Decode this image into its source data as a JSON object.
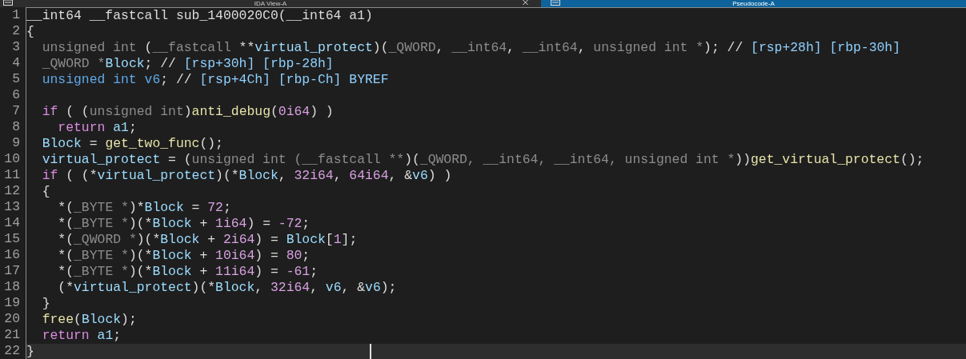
{
  "tabs": [
    {
      "label": "IDA View-A",
      "selected": false,
      "closable": true
    },
    {
      "label": "Pseudocode-A",
      "selected": true,
      "closable": false
    }
  ],
  "lines": [
    {
      "number": "1",
      "selected": false,
      "tokens": [
        {
          "kind": "plain",
          "text": "__int64 __fastcall sub_1400020C0(__int64 a1)"
        }
      ]
    },
    {
      "number": "2",
      "selected": false,
      "tokens": [
        {
          "kind": "plain",
          "text": "{"
        }
      ]
    },
    {
      "number": "3",
      "selected": false,
      "tokens": [
        {
          "kind": "type",
          "text": "  unsigned int"
        },
        {
          "kind": "plain",
          "text": " ("
        },
        {
          "kind": "type",
          "text": "__fastcall"
        },
        {
          "kind": "plain",
          "text": " **"
        },
        {
          "kind": "variable",
          "text": "virtual_protect"
        },
        {
          "kind": "plain",
          "text": ")("
        },
        {
          "kind": "type",
          "text": "_QWORD"
        },
        {
          "kind": "plain",
          "text": ", "
        },
        {
          "kind": "type",
          "text": "__int64"
        },
        {
          "kind": "plain",
          "text": ", "
        },
        {
          "kind": "type",
          "text": "__int64"
        },
        {
          "kind": "plain",
          "text": ", "
        },
        {
          "kind": "type",
          "text": "unsigned int *"
        },
        {
          "kind": "plain",
          "text": "); // "
        },
        {
          "kind": "ref",
          "text": "[rsp+28h] [rbp-30h]"
        }
      ]
    },
    {
      "number": "4",
      "selected": false,
      "tokens": [
        {
          "kind": "type",
          "text": "  _QWORD *"
        },
        {
          "kind": "variable",
          "text": "Block"
        },
        {
          "kind": "plain",
          "text": "; // "
        },
        {
          "kind": "ref",
          "text": "[rsp+30h] [rbp-28h]"
        }
      ]
    },
    {
      "number": "5",
      "selected": false,
      "tokens": [
        {
          "kind": "decl",
          "text": "  unsigned int v6"
        },
        {
          "kind": "plain",
          "text": "; // "
        },
        {
          "kind": "ref",
          "text": "[rsp+4Ch] [rbp-Ch] BYREF"
        }
      ]
    },
    {
      "number": "6",
      "selected": false
    },
    {
      "number": "7",
      "selected": false,
      "tokens": [
        {
          "kind": "keyword",
          "text": "  if"
        },
        {
          "kind": "plain",
          "text": " ( ("
        },
        {
          "kind": "type",
          "text": "unsigned int"
        },
        {
          "kind": "plain",
          "text": ")"
        },
        {
          "kind": "function",
          "text": "anti_debug"
        },
        {
          "kind": "plain",
          "text": "("
        },
        {
          "kind": "number",
          "text": "0i64"
        },
        {
          "kind": "plain",
          "text": ") )"
        }
      ]
    },
    {
      "number": "8",
      "selected": false,
      "tokens": [
        {
          "kind": "keyword",
          "text": "    return"
        },
        {
          "kind": "variable",
          "text": " a1"
        },
        {
          "kind": "plain",
          "text": ";"
        }
      ]
    },
    {
      "number": "9",
      "selected": false,
      "tokens": [
        {
          "kind": "variable",
          "text": "  Block"
        },
        {
          "kind": "plain",
          "text": " = "
        },
        {
          "kind": "function",
          "text": "get_two_func"
        },
        {
          "kind": "plain",
          "text": "();"
        }
      ]
    },
    {
      "number": "10",
      "selected": false,
      "tokens": [
        {
          "kind": "variable",
          "text": "  virtual_protect"
        },
        {
          "kind": "plain",
          "text": " = ("
        },
        {
          "kind": "type",
          "text": "unsigned int (__fastcall **"
        },
        {
          "kind": "plain",
          "text": ")("
        },
        {
          "kind": "type",
          "text": "_QWORD, __int64, __int64, unsigned int *"
        },
        {
          "kind": "plain",
          "text": "))"
        },
        {
          "kind": "function",
          "text": "get_virtual_protect"
        },
        {
          "kind": "plain",
          "text": "();"
        }
      ]
    },
    {
      "number": "11",
      "selected": false,
      "tokens": [
        {
          "kind": "keyword",
          "text": "  if"
        },
        {
          "kind": "plain",
          "text": " ( (*"
        },
        {
          "kind": "variable",
          "text": "virtual_protect"
        },
        {
          "kind": "plain",
          "text": ")(*"
        },
        {
          "kind": "variable",
          "text": "Block"
        },
        {
          "kind": "plain",
          "text": ", "
        },
        {
          "kind": "number",
          "text": "32i64"
        },
        {
          "kind": "plain",
          "text": ", "
        },
        {
          "kind": "number",
          "text": "64i64"
        },
        {
          "kind": "plain",
          "text": ", &"
        },
        {
          "kind": "variable",
          "text": "v6"
        },
        {
          "kind": "plain",
          "text": ") )"
        }
      ]
    },
    {
      "number": "12",
      "selected": false,
      "tokens": [
        {
          "kind": "plain",
          "text": "  {"
        }
      ]
    },
    {
      "number": "13",
      "selected": false,
      "tokens": [
        {
          "kind": "plain",
          "text": "    *("
        },
        {
          "kind": "type",
          "text": "_BYTE *"
        },
        {
          "kind": "plain",
          "text": ")*"
        },
        {
          "kind": "variable",
          "text": "Block"
        },
        {
          "kind": "plain",
          "text": " = "
        },
        {
          "kind": "number",
          "text": "72"
        },
        {
          "kind": "plain",
          "text": ";"
        }
      ]
    },
    {
      "number": "14",
      "selected": false,
      "tokens": [
        {
          "kind": "plain",
          "text": "    *("
        },
        {
          "kind": "type",
          "text": "_BYTE *"
        },
        {
          "kind": "plain",
          "text": ")(*"
        },
        {
          "kind": "variable",
          "text": "Block"
        },
        {
          "kind": "plain",
          "text": " + "
        },
        {
          "kind": "number",
          "text": "1i64"
        },
        {
          "kind": "plain",
          "text": ") = "
        },
        {
          "kind": "number",
          "text": "-72"
        },
        {
          "kind": "plain",
          "text": ";"
        }
      ]
    },
    {
      "number": "15",
      "selected": false,
      "tokens": [
        {
          "kind": "plain",
          "text": "    *("
        },
        {
          "kind": "type",
          "text": "_QWORD *"
        },
        {
          "kind": "plain",
          "text": ")(*"
        },
        {
          "kind": "variable",
          "text": "Block"
        },
        {
          "kind": "plain",
          "text": " + "
        },
        {
          "kind": "number",
          "text": "2i64"
        },
        {
          "kind": "plain",
          "text": ") = "
        },
        {
          "kind": "variable",
          "text": "Block"
        },
        {
          "kind": "plain",
          "text": "["
        },
        {
          "kind": "number",
          "text": "1"
        },
        {
          "kind": "plain",
          "text": "];"
        }
      ]
    },
    {
      "number": "16",
      "selected": false,
      "tokens": [
        {
          "kind": "plain",
          "text": "    *("
        },
        {
          "kind": "type",
          "text": "_BYTE *"
        },
        {
          "kind": "plain",
          "text": ")(*"
        },
        {
          "kind": "variable",
          "text": "Block"
        },
        {
          "kind": "plain",
          "text": " + "
        },
        {
          "kind": "number",
          "text": "10i64"
        },
        {
          "kind": "plain",
          "text": ") = "
        },
        {
          "kind": "number",
          "text": "80"
        },
        {
          "kind": "plain",
          "text": ";"
        }
      ]
    },
    {
      "number": "17",
      "selected": false,
      "tokens": [
        {
          "kind": "plain",
          "text": "    *("
        },
        {
          "kind": "type",
          "text": "_BYTE *"
        },
        {
          "kind": "plain",
          "text": ")(*"
        },
        {
          "kind": "variable",
          "text": "Block"
        },
        {
          "kind": "plain",
          "text": " + "
        },
        {
          "kind": "number",
          "text": "11i64"
        },
        {
          "kind": "plain",
          "text": ") = "
        },
        {
          "kind": "number",
          "text": "-61"
        },
        {
          "kind": "plain",
          "text": ";"
        }
      ]
    },
    {
      "number": "18",
      "selected": false,
      "tokens": [
        {
          "kind": "plain",
          "text": "    (*"
        },
        {
          "kind": "variable",
          "text": "virtual_protect"
        },
        {
          "kind": "plain",
          "text": ")(*"
        },
        {
          "kind": "variable",
          "text": "Block"
        },
        {
          "kind": "plain",
          "text": ", "
        },
        {
          "kind": "number",
          "text": "32i64"
        },
        {
          "kind": "plain",
          "text": ", "
        },
        {
          "kind": "variable",
          "text": "v6"
        },
        {
          "kind": "plain",
          "text": ", &"
        },
        {
          "kind": "variable",
          "text": "v6"
        },
        {
          "kind": "plain",
          "text": ");"
        }
      ]
    },
    {
      "number": "19",
      "selected": false,
      "tokens": [
        {
          "kind": "plain",
          "text": "  }"
        }
      ]
    },
    {
      "number": "20",
      "selected": false,
      "tokens": [
        {
          "kind": "function",
          "text": "  free"
        },
        {
          "kind": "plain",
          "text": "("
        },
        {
          "kind": "variable",
          "text": "Block"
        },
        {
          "kind": "plain",
          "text": ");"
        }
      ]
    },
    {
      "number": "21",
      "selected": false,
      "tokens": [
        {
          "kind": "keyword",
          "text": "  return"
        },
        {
          "kind": "variable",
          "text": " a1"
        },
        {
          "kind": "plain",
          "text": ";"
        }
      ]
    },
    {
      "number": "22",
      "selected": true,
      "tokens": [
        {
          "kind": "plain",
          "text": "}"
        }
      ]
    }
  ]
}
